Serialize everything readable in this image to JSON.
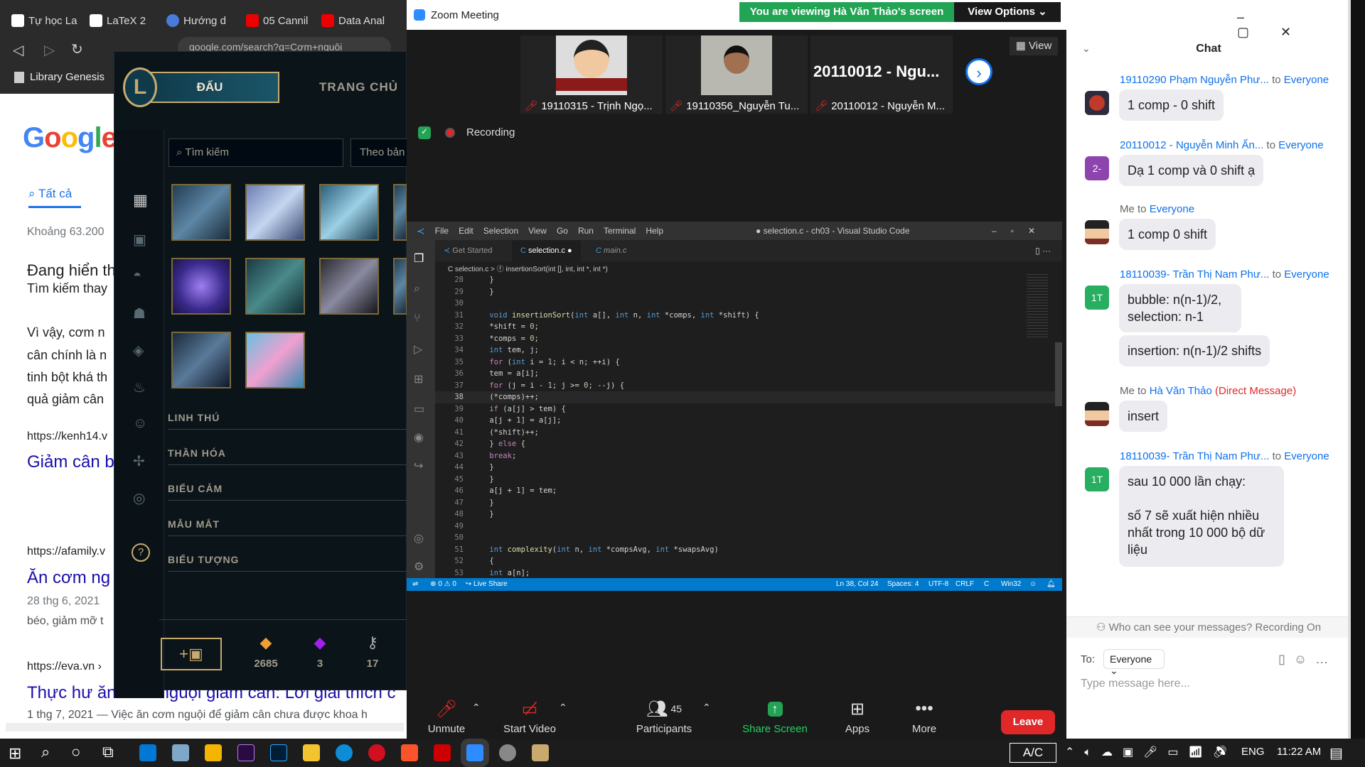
{
  "browser": {
    "tabs": [
      "Tự học La",
      "LaTeX 2",
      "Hướng d",
      "05 Cannil",
      "Data Anal"
    ],
    "bookmark": "Library Genesis",
    "url": "google.com/search?q=Cơm+nguội",
    "google_logo": "Google",
    "search_tab": "Tất cả",
    "result_count": "Khoảng 63.200",
    "texts": [
      "Đang hiển th",
      "Tìm kiếm thay",
      "Vì vậy, cơm n",
      "cân chính là n",
      "tinh bột khá th",
      "quả giảm cân",
      "https://kenh14.v",
      "Giảm cân b",
      "https://afamily.v",
      "Ăn cơm ng",
      "28 thg 6, 2021",
      "béo, giảm mỡ t",
      "https://eva.vn ›",
      "Thực hư ăn cơm nguội giảm cân: Lời giải thích c",
      "1 thg 7, 2021 — Việc ăn cơm nguội để giảm cân chưa được khoa h"
    ]
  },
  "lol": {
    "play": "ĐẤU",
    "home": "TRANG CHỦ",
    "search_placeholder": "Tìm kiếm",
    "filter": "Theo bản",
    "sections": [
      "LINH THÚ",
      "THẦN HÓA",
      "BIỂU CẢM",
      "MẪU MẮT",
      "BIỂU TƯỢNG"
    ],
    "currency": [
      {
        "icon": "be-icon",
        "value": "2685",
        "color": "#f0a030"
      },
      {
        "icon": "rp-icon",
        "value": "3",
        "color": "#a020f0"
      },
      {
        "icon": "key-icon",
        "value": "17",
        "color": "#aaa"
      }
    ]
  },
  "zoom": {
    "title": "Zoom Meeting",
    "viewing_banner": "You are viewing Hà Văn Thảo's screen",
    "view_options": "View Options",
    "view_btn": "View",
    "recording": "Recording",
    "participants": [
      {
        "name": "19110315 - Trịnh Ngọ..."
      },
      {
        "name": "19110356_Nguyễn Tu..."
      },
      {
        "name": "20110012 - Nguyễn M...",
        "big_label": "20110012 - Ngu..."
      }
    ],
    "toolbar": {
      "unmute": "Unmute",
      "start_video": "Start Video",
      "participants": "Participants",
      "participants_count": "45",
      "share": "Share Screen",
      "apps": "Apps",
      "more": "More",
      "leave": "Leave"
    }
  },
  "vscode": {
    "menu": [
      "File",
      "Edit",
      "Selection",
      "View",
      "Go",
      "Run",
      "Terminal",
      "Help"
    ],
    "title": "● selection.c - ch03 - Visual Studio Code",
    "tabs": [
      "Get Started",
      "selection.c",
      "main.c"
    ],
    "breadcrumb": "C selection.c > ⓕ insertionSort(int [], int, int *, int *)",
    "status": {
      "errors": "⊗ 0 ⚠ 0",
      "live_share": "Live Share",
      "position": "Ln 38, Col 24",
      "spaces": "Spaces: 4",
      "encoding": "UTF-8",
      "eol": "CRLF",
      "lang": "C",
      "platform": "Win32"
    },
    "code_lines": [
      "28",
      "29",
      "30",
      "31",
      "32",
      "33",
      "34",
      "35",
      "36",
      "37",
      "38",
      "39",
      "40",
      "41",
      "42",
      "43",
      "44",
      "45",
      "46",
      "47",
      "48",
      "49",
      "50",
      "51",
      "52",
      "53"
    ]
  },
  "chat": {
    "title": "Chat",
    "messages": [
      {
        "from": "19110290 Phạm Nguyễn Phư...",
        "to": "Everyone",
        "text": "1 comp - 0 shift",
        "avatar": "img",
        "color": "#c0392b"
      },
      {
        "from": "20110012 - Nguyễn Minh Ấn...",
        "to": "Everyone",
        "text": "Dạ 1 comp và 0 shift ạ",
        "avatar": "2-",
        "color": "#8e44ad"
      },
      {
        "from": "Me",
        "to": "Everyone",
        "text": "1 comp 0 shift",
        "avatar": "me",
        "color": "#7b2d26"
      },
      {
        "from": "18110039- Trần Thị Nam Phư...",
        "to": "Everyone",
        "text": "bubble: n(n-1)/2, selection: n-1",
        "text2": "insertion: n(n-1)/2 shifts",
        "avatar": "1T",
        "color": "#27ae60"
      },
      {
        "from": "Me",
        "to": "Hà Văn Thảo",
        "dm": "(Direct Message)",
        "text": "insert",
        "avatar": "me",
        "color": "#7b2d26"
      },
      {
        "from": "18110039- Trần Thị Nam Phư...",
        "to": "Everyone",
        "text": "sau 10 000 lần chạy:",
        "text2": "số 7 sẽ xuất hiện nhiều nhất trong 10 000 bộ dữ liệu",
        "avatar": "1T",
        "color": "#27ae60"
      }
    ],
    "who_can_see": "Who can see your messages? Recording On",
    "to_label": "To:",
    "to_value": "Everyone",
    "placeholder": "Type message here..."
  },
  "taskbar": {
    "ac": "A/C",
    "lang": "ENG",
    "time": "11:22 AM"
  }
}
